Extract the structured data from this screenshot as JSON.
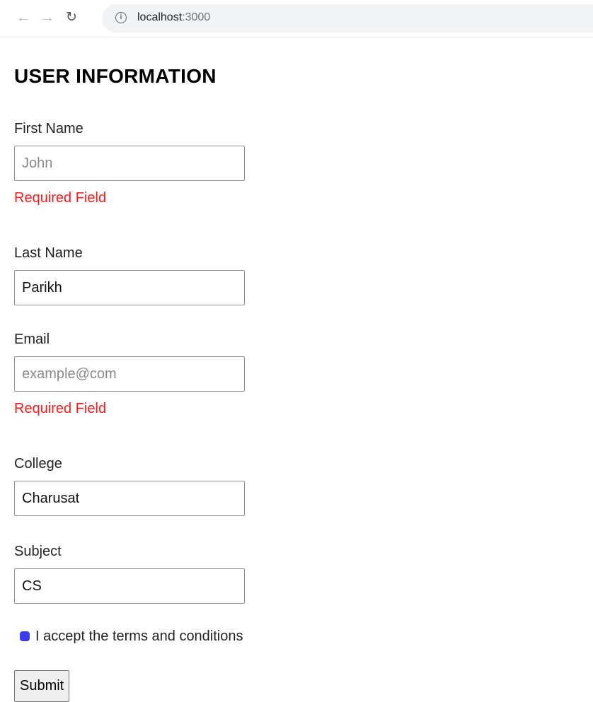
{
  "browser": {
    "url_host": "localhost",
    "url_port": ":3000"
  },
  "page": {
    "title": "USER INFORMATION"
  },
  "form": {
    "first_name": {
      "label": "First Name",
      "value": "",
      "placeholder": "John",
      "error": "Required Field"
    },
    "last_name": {
      "label": "Last Name",
      "value": "Parikh",
      "placeholder": ""
    },
    "email": {
      "label": "Email",
      "value": "",
      "placeholder": "example@com",
      "error": "Required Field"
    },
    "college": {
      "label": "College",
      "value": "Charusat",
      "placeholder": ""
    },
    "subject": {
      "label": "Subject",
      "value": "CS",
      "placeholder": ""
    },
    "terms": {
      "label": "I accept the terms and conditions",
      "checked": true
    },
    "submit_label": "Submit"
  },
  "colors": {
    "error": "#ff1a1a",
    "checkbox": "#3b3bf0"
  }
}
